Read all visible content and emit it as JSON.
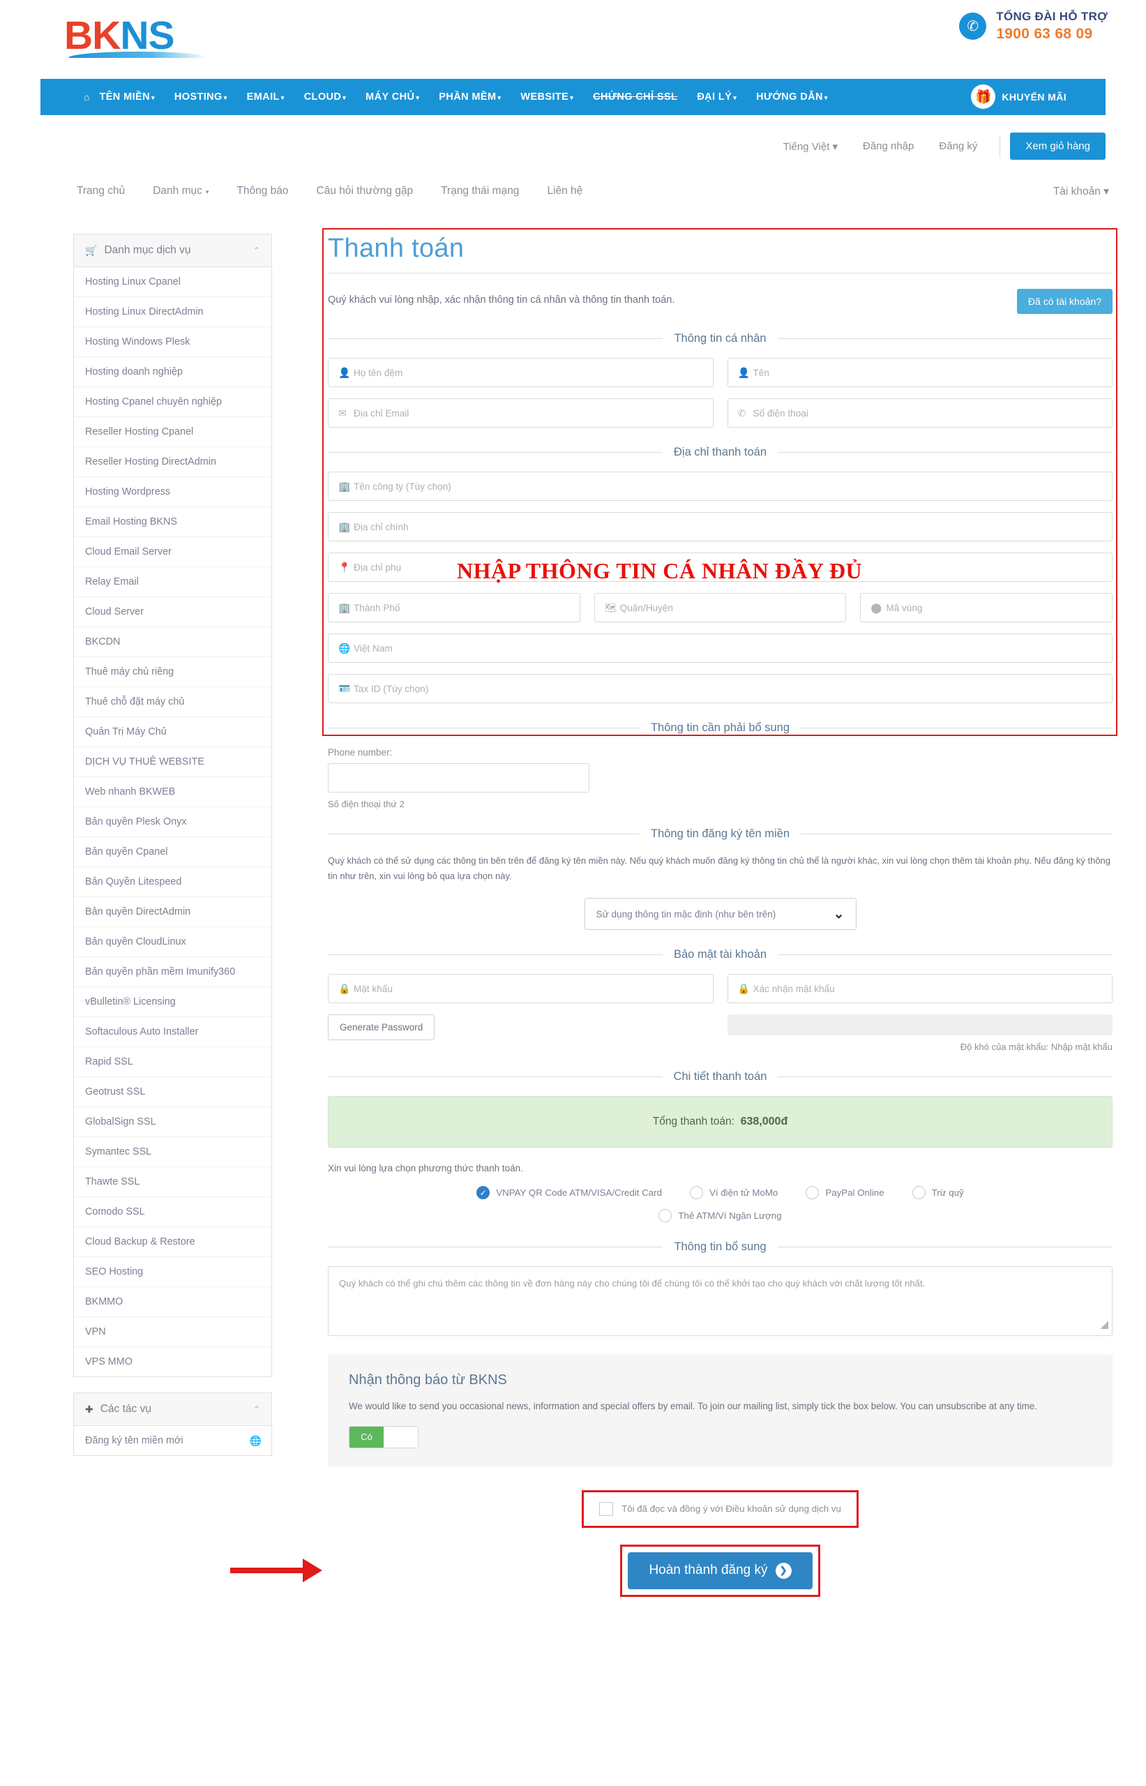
{
  "header": {
    "logo_bk": "BK",
    "logo_ns": "NS",
    "support_label": "TỔNG ĐÀI HỖ TRỢ",
    "support_phone": "1900 63 68 09",
    "phone_icon": "phone-icon"
  },
  "mainnav": {
    "home_icon": "home-icon",
    "items": [
      {
        "label": "TÊN MIỀN",
        "caret": "▾",
        "strike": false
      },
      {
        "label": "HOSTING",
        "caret": "▾",
        "strike": false
      },
      {
        "label": "EMAIL",
        "caret": "▾",
        "strike": false
      },
      {
        "label": "CLOUD",
        "caret": "▾",
        "strike": false
      },
      {
        "label": "MÁY CHỦ",
        "caret": "▾",
        "strike": false
      },
      {
        "label": "PHẦN MỀM",
        "caret": "▾",
        "strike": false
      },
      {
        "label": "WEBSITE",
        "caret": "▾",
        "strike": false
      },
      {
        "label": "CHỨNG CHỈ SSL",
        "caret": "",
        "strike": true
      },
      {
        "label": "ĐẠI LÝ",
        "caret": "▾",
        "strike": false
      },
      {
        "label": "HƯỚNG DẪN",
        "caret": "▾",
        "strike": false
      }
    ],
    "promo_label": "KHUYẾN MÃI",
    "promo_icon": "gift-icon"
  },
  "utility": {
    "language": "Tiếng Việt",
    "language_caret": "▾",
    "login": "Đăng nhập",
    "register": "Đăng ký",
    "cart_button": "Xem giỏ hàng"
  },
  "breadcrumb": {
    "items": [
      "Trang chủ",
      "Danh mục",
      "Thông báo",
      "Câu hỏi thường gặp",
      "Trạng thái mạng",
      "Liên hệ"
    ],
    "danhmuc_caret": "▾",
    "account": "Tài khoản",
    "account_caret": "▾"
  },
  "sidebar": {
    "services_panel": {
      "title": "Danh mục dịch vụ",
      "icon": "cart-icon",
      "collapse_icon": "chevron-up-icon",
      "items": [
        "Hosting Linux Cpanel",
        "Hosting Linux DirectAdmin",
        "Hosting Windows Plesk",
        "Hosting doanh nghiệp",
        "Hosting Cpanel chuyên nghiệp",
        "Reseller Hosting Cpanel",
        "Reseller Hosting DirectAdmin",
        "Hosting Wordpress",
        "Email Hosting BKNS",
        "Cloud Email Server",
        "Relay Email",
        "Cloud Server",
        "BKCDN",
        "Thuê máy chủ riêng",
        "Thuê chỗ đặt máy chủ",
        "Quản Trị Máy Chủ",
        "DỊCH VỤ THUÊ WEBSITE",
        "Web nhanh BKWEB",
        "Bản quyền Plesk Onyx",
        "Bản quyền Cpanel",
        "Bản Quyền Litespeed",
        "Bản quyền DirectAdmin",
        "Bản quyền CloudLinux",
        "Bản quyền phần mềm Imunify360",
        "vBulletin® Licensing",
        "Softaculous Auto Installer",
        "Rapid SSL",
        "Geotrust SSL",
        "GlobalSign SSL",
        "Symantec SSL",
        "Thawte SSL",
        "Comodo SSL",
        "Cloud Backup & Restore",
        "SEO Hosting",
        "BKMMO",
        "VPN",
        "VPS MMO"
      ]
    },
    "actions_panel": {
      "title": "Các tác vụ",
      "icon": "plus-icon",
      "collapse_icon": "chevron-up-icon",
      "items": [
        {
          "label": "Đăng ký tên miền mới",
          "icon": "globe-icon"
        }
      ]
    }
  },
  "main": {
    "page_title": "Thanh toán",
    "intro_text": "Quý khách vui lòng nhập, xác nhận thông tin cá nhân và thông tin thanh toán.",
    "have_account_button": "Đã có tài khoản?",
    "annotation": "NHẬP THÔNG TIN CÁ NHÂN ĐẦY ĐỦ",
    "annotation_color": "#e8120c",
    "sections": {
      "personal": "Thông tin cá nhân",
      "billing": "Địa chỉ thanh toán",
      "additional": "Thông tin cần phải bổ sung",
      "domain": "Thông tin đăng ký tên miền",
      "security": "Bảo mật tài khoản",
      "payment_detail": "Chi tiết thanh toán",
      "extra_info": "Thông tin bổ sung"
    },
    "personal_fields": [
      {
        "placeholder": "Họ tên đệm",
        "icon": "user-icon"
      },
      {
        "placeholder": "Tên",
        "icon": "user-icon"
      },
      {
        "placeholder": "Địa chỉ Email",
        "icon": "envelope-icon"
      },
      {
        "placeholder": "Số điện thoại",
        "icon": "phone-icon"
      }
    ],
    "billing_fields": {
      "company": {
        "placeholder": "Tên công ty (Tùy chọn)",
        "icon": "building-icon"
      },
      "address1": {
        "placeholder": "Địa chỉ chính",
        "icon": "building-icon"
      },
      "address2": {
        "placeholder": "Địa chỉ phụ",
        "icon": "map-pin-icon"
      },
      "city": {
        "placeholder": "Thành Phố",
        "icon": "building-icon"
      },
      "district": {
        "placeholder": "Quận/Huyện",
        "icon": "map-icon"
      },
      "zip": {
        "placeholder": "Mã vùng",
        "icon": "circle-icon"
      },
      "country": {
        "placeholder": "Việt Nam",
        "icon": "globe-icon"
      },
      "taxid": {
        "placeholder": "Tax ID (Tùy chọn)",
        "icon": "id-icon"
      }
    },
    "additional": {
      "phone_label": "Phone number:",
      "phone_value": "",
      "phone_helper": "Số điện thoại thứ 2"
    },
    "domain_section": {
      "paragraph": "Quý khách có thể sử dụng các thông tin bên trên để đăng ký tên miền này. Nếu quý khách muốn đăng ký thông tin chủ thể là người khác, xin vui lòng chọn thêm tài khoản phụ. Nếu đăng ký thông tin như trên, xin vui lòng bỏ qua lựa chọn này.",
      "select_value": "Sử dụng thông tin mặc định (như bên trên)",
      "select_caret": "chevron-down-icon"
    },
    "security": {
      "password": {
        "placeholder": "Mật khẩu",
        "icon": "lock-icon"
      },
      "confirm": {
        "placeholder": "Xác nhận mật khẩu",
        "icon": "lock-icon"
      },
      "generate_button": "Generate Password",
      "strength_note": "Độ khó của mật khẩu: Nhập mật khẩu"
    },
    "payment": {
      "total_label": "Tổng thanh toán:",
      "total_value": "638,000đ",
      "choose_text": "Xin vui lòng lựa chọn phương thức thanh toán.",
      "options_row1": [
        {
          "label": "VNPAY QR Code ATM/VISA/Credit Card",
          "selected": true
        },
        {
          "label": "Ví điện tử MoMo",
          "selected": false
        },
        {
          "label": "PayPal Online",
          "selected": false
        },
        {
          "label": "Trừ quỹ",
          "selected": false
        }
      ],
      "options_row2": [
        {
          "label": "Thẻ ATM/Ví Ngân Lượng",
          "selected": false
        }
      ]
    },
    "notes_placeholder": "Quý khách có thể ghi chú thêm các thông tin về đơn hàng này cho chúng tôi để chúng tôi có thể khởi tạo cho quý khách với chất lượng tốt nhất.",
    "newsletter": {
      "title": "Nhận thông báo từ BKNS",
      "text": "We would like to send you occasional news, information and special offers by email. To join our mailing list, simply tick the box below. You can unsubscribe at any time.",
      "toggle_on_label": "Có"
    },
    "terms": {
      "checkbox_label": "Tôi đã đọc và đồng ý với Điều khoản sử dụng dịch vụ",
      "checked": false
    },
    "submit": {
      "label": "Hoàn thành đăng ký",
      "arrow_icon": "chevron-right-icon"
    }
  }
}
